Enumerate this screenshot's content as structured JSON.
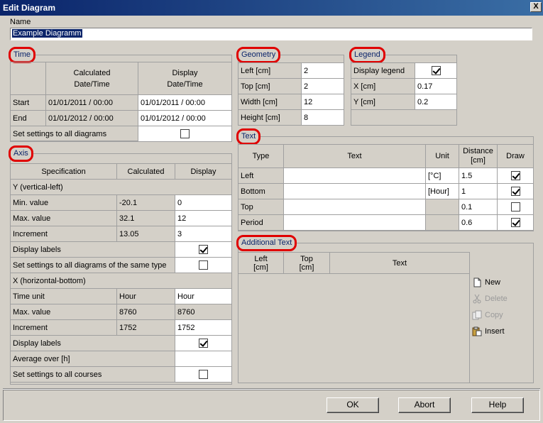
{
  "window": {
    "title": "Edit Diagram",
    "close_glyph": "X"
  },
  "name": {
    "label": "Name",
    "value": "Example Diagramm"
  },
  "time": {
    "title": "Time",
    "headers": [
      "Calculated\nDate/Time",
      "Display\nDate/Time"
    ],
    "rows": [
      {
        "label": "Start",
        "calculated": "01/01/2011 / 00:00",
        "display": "01/01/2011 / 00:00"
      },
      {
        "label": "End",
        "calculated": "01/01/2012 / 00:00",
        "display": "01/01/2012 / 00:00"
      }
    ],
    "set_all_label": "Set settings to all diagrams",
    "set_all_checked": false
  },
  "axis": {
    "title": "Axis",
    "headers": [
      "Specification",
      "Calculated",
      "Display"
    ],
    "y_label": "Y (vertical-left)",
    "y_rows": [
      {
        "label": "Min. value",
        "calculated": "-20.1",
        "display": "0"
      },
      {
        "label": "Max. value",
        "calculated": "32.1",
        "display": "12"
      },
      {
        "label": "Increment",
        "calculated": "13.05",
        "display": "3"
      }
    ],
    "y_display_labels": "Display labels",
    "y_display_labels_checked": true,
    "y_set_all": "Set settings to all diagrams of the same type",
    "y_set_all_checked": false,
    "x_label": "X (horizontal-bottom)",
    "x_rows": [
      {
        "label": "Time unit",
        "calculated": "Hour",
        "display": "Hour"
      },
      {
        "label": "Max. value",
        "calculated": "8760",
        "display": "8760"
      },
      {
        "label": "Increment",
        "calculated": "1752",
        "display": "1752"
      }
    ],
    "x_display_labels": "Display labels",
    "x_display_labels_checked": true,
    "average_label": "Average over [h]",
    "average_value": "",
    "x_set_all": "Set settings to all courses",
    "x_set_all_checked": false
  },
  "geometry": {
    "title": "Geometry",
    "rows": [
      {
        "label": "Left  [cm]",
        "value": "2"
      },
      {
        "label": "Top  [cm]",
        "value": "2"
      },
      {
        "label": "Width  [cm]",
        "value": "12"
      },
      {
        "label": "Height  [cm]",
        "value": "8"
      }
    ]
  },
  "legend": {
    "title": "Legend",
    "display_label": "Display legend",
    "display_checked": true,
    "rows": [
      {
        "label": "X  [cm]",
        "value": "0.17"
      },
      {
        "label": "Y  [cm]",
        "value": "0.2"
      }
    ]
  },
  "text": {
    "title": "Text",
    "headers": [
      "Type",
      "Text",
      "Unit",
      "Distance\n[cm]",
      "Draw"
    ],
    "rows": [
      {
        "type": "Left",
        "text": "",
        "unit": "[°C]",
        "distance": "1.5",
        "draw": true
      },
      {
        "type": "Bottom",
        "text": "",
        "unit": "[Hour]",
        "distance": "1",
        "draw": true
      },
      {
        "type": "Top",
        "text": "",
        "unit": "",
        "distance": "0.1",
        "draw": false
      },
      {
        "type": "Period",
        "text": "",
        "unit": "",
        "distance": "0.6",
        "draw": true
      }
    ]
  },
  "additional_text": {
    "title": "Additional Text",
    "headers": [
      "Left\n[cm]",
      "Top\n[cm]",
      "Text"
    ],
    "buttons": {
      "new": "New",
      "delete": "Delete",
      "copy": "Copy",
      "insert": "Insert"
    }
  },
  "footer": {
    "ok": "OK",
    "abort": "Abort",
    "help": "Help"
  },
  "colors": {
    "title_bar": "#0a246a",
    "highlight_ring": "#e00000",
    "dialog_bg": "#d4d0c8"
  }
}
